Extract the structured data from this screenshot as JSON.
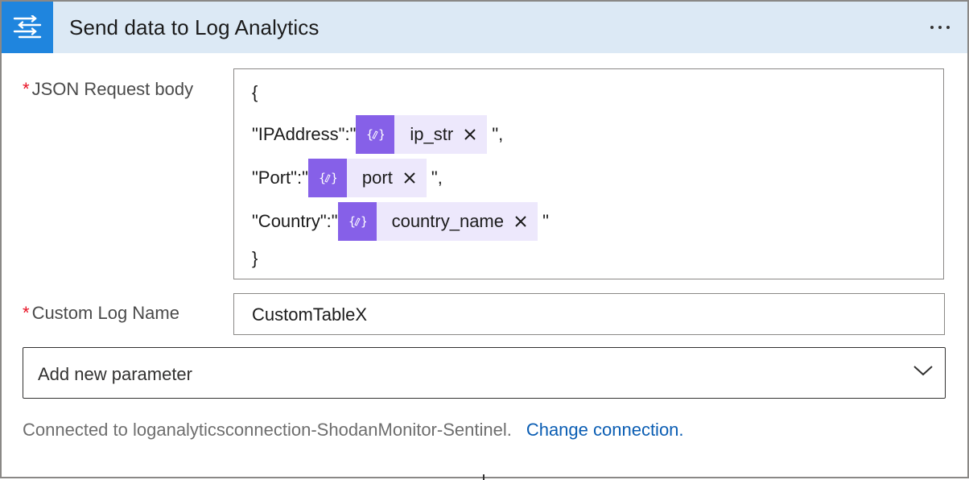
{
  "header": {
    "title": "Send data to Log Analytics",
    "icon": "flow-lines-icon",
    "more_icon": "more-ellipsis-icon",
    "accent_color": "#1f85de",
    "header_bg": "#dce9f5"
  },
  "json_field": {
    "required_mark": "*",
    "label": "JSON Request body",
    "lines": {
      "open_brace": "{",
      "ip_key": "\"IPAddress\":\"",
      "ip_token": "ip_str",
      "ip_suffix": " \",",
      "port_key": "\"Port\":\"",
      "port_token": "port",
      "port_suffix": " \",",
      "country_key": "\"Country\":\"",
      "country_token": "country_name",
      "country_suffix": " \"",
      "close_brace": "}"
    },
    "token_icon": "dynamic-content-icon",
    "token_color": "#8660e8"
  },
  "log_name_field": {
    "required_mark": "*",
    "label": "Custom Log Name",
    "value": "CustomTableX"
  },
  "add_parameter": {
    "label": "Add new parameter",
    "icon": "chevron-down-icon"
  },
  "footer": {
    "connection_text": "Connected to loganalyticsconnection-ShodanMonitor-Sentinel.",
    "change_link": "Change connection."
  }
}
